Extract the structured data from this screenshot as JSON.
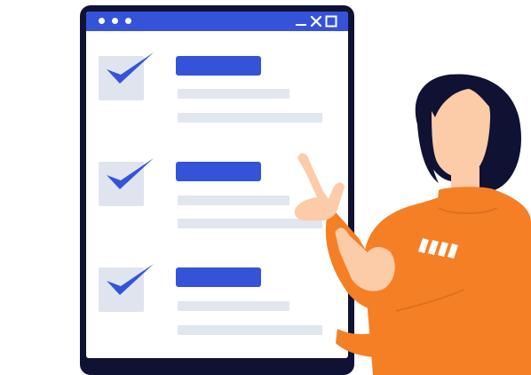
{
  "illustration": {
    "subject": "checklist-window-with-person-pointing",
    "colors": {
      "device_frame": "#0f1233",
      "titlebar": "#3553d8",
      "checkbox_bg": "#dfe4ef",
      "checkmark": "#3553d8",
      "placeholder_line": "#e2e6ef",
      "sweater": "#f57f25",
      "hair": "#0f1233",
      "skin": "#fccba8"
    }
  },
  "window": {
    "controls": [
      "minimize-icon",
      "close-icon",
      "maximize-icon"
    ]
  },
  "checklist": {
    "items": [
      {
        "checked": true
      },
      {
        "checked": true
      },
      {
        "checked": true
      }
    ]
  }
}
